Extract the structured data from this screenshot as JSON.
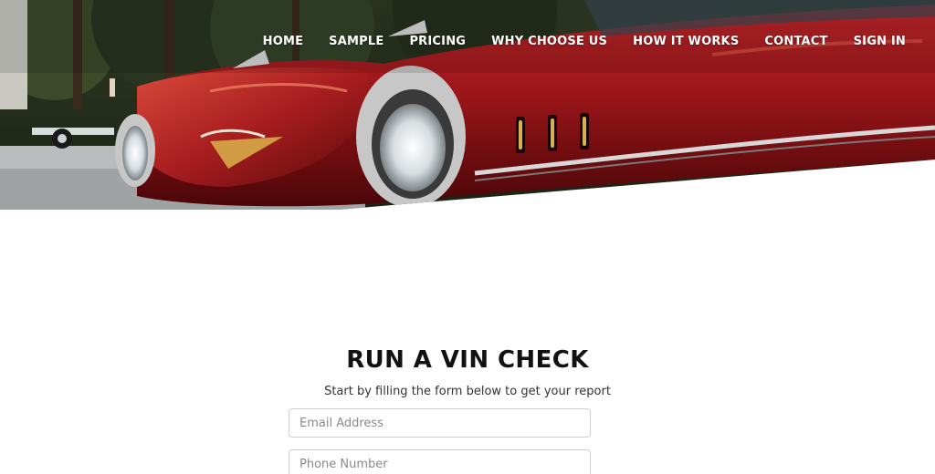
{
  "nav": {
    "items": [
      {
        "label": "HOME",
        "name": "nav-home"
      },
      {
        "label": "SAMPLE",
        "name": "nav-sample"
      },
      {
        "label": "PRICING",
        "name": "nav-pricing"
      },
      {
        "label": "WHY CHOOSE US",
        "name": "nav-why-choose-us"
      },
      {
        "label": "HOW IT WORKS",
        "name": "nav-how-it-works"
      },
      {
        "label": "CONTACT",
        "name": "nav-contact"
      },
      {
        "label": "SIGN IN",
        "name": "nav-sign-in"
      }
    ]
  },
  "hero": {
    "image": "red-classic-car-photo"
  },
  "form": {
    "title": "RUN A VIN CHECK",
    "subtitle": "Start by filling the form below to get your report",
    "email_placeholder": "Email Address",
    "phone_placeholder": "Phone Number"
  },
  "colors": {
    "car_red": "#8e1418",
    "text_dark": "#111111",
    "nav_text": "#ffffff",
    "field_border": "#cfcfcf"
  }
}
